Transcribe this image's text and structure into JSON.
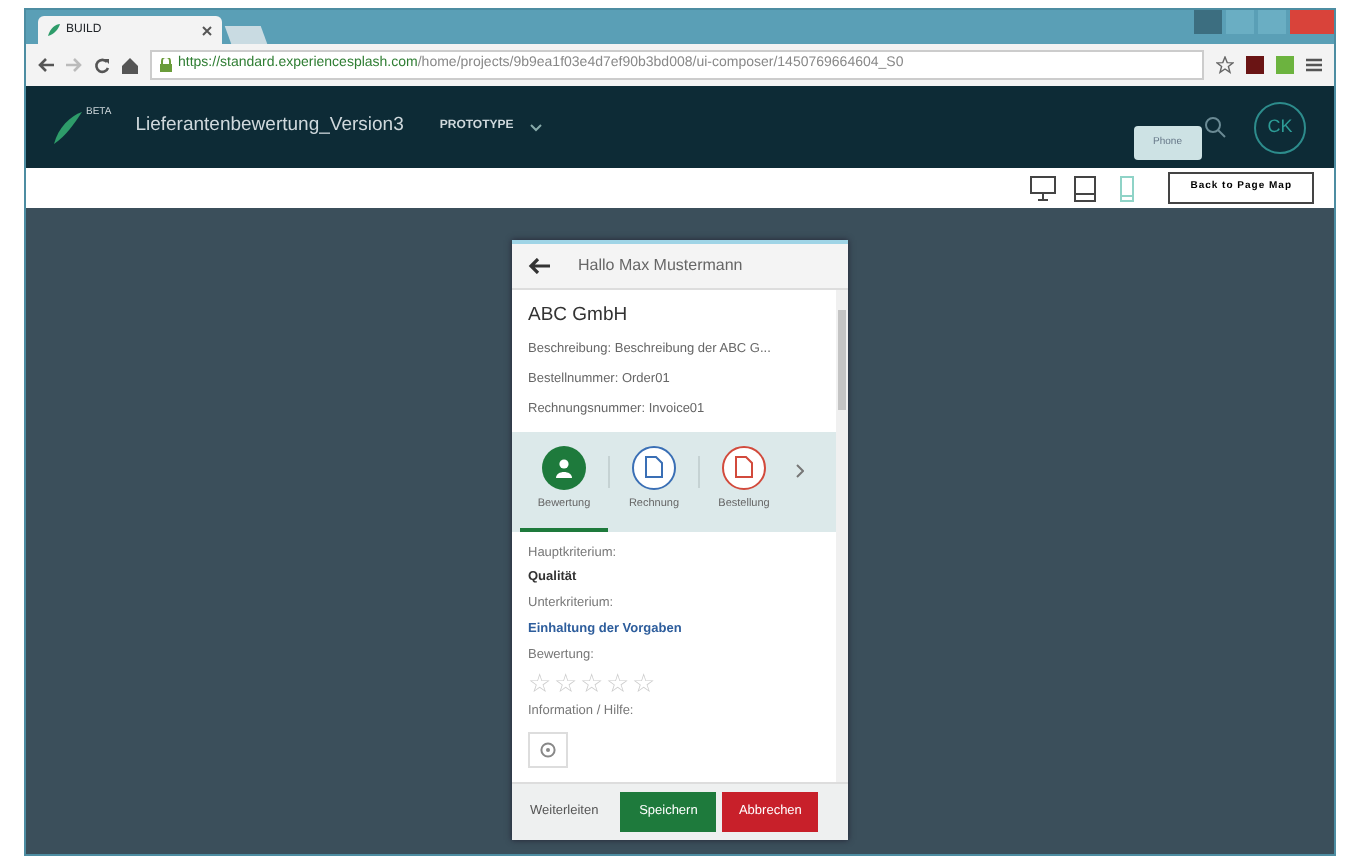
{
  "browser": {
    "tab_title": "BUILD",
    "url_host": "https://standard.experiencesplash.com",
    "url_path": "/home/projects/9b9ea1f03e4d7ef90b3bd008/ui-composer/1450769664604_S0"
  },
  "app": {
    "badge": "BETA",
    "project": "Lieferantenbewertung_Version3",
    "mode": "PROTOTYPE",
    "avatar": "CK"
  },
  "tooltip": "Phone",
  "devices": [
    {
      "kind": "desktop",
      "selected": false
    },
    {
      "kind": "tablet",
      "selected": false
    },
    {
      "kind": "phone",
      "selected": true
    }
  ],
  "back_button": "Back to Page Map",
  "phone": {
    "header": "Hallo Max Mustermann",
    "company": "ABC GmbH",
    "details": [
      "Beschreibung: Beschreibung der ABC G...",
      "Bestellnummer: Order01",
      "Rechnungsnummer: Invoice01"
    ],
    "tabs": [
      {
        "label": "Bewertung",
        "selected": true,
        "color": "#1e7a3c"
      },
      {
        "label": "Rechnung",
        "selected": false,
        "color": "#3a6fb5"
      },
      {
        "label": "Bestellung",
        "selected": false,
        "color": "#d24a3c"
      }
    ],
    "fields": [
      {
        "kind": "label",
        "text": "Hauptkriterium:"
      },
      {
        "kind": "value",
        "text": "Qualität"
      },
      {
        "kind": "label",
        "text": "Unterkriterium:"
      },
      {
        "kind": "link",
        "text": "Einhaltung der Vorgaben"
      },
      {
        "kind": "label",
        "text": "Bewertung:"
      },
      {
        "kind": "rating",
        "stars": 0
      },
      {
        "kind": "label",
        "text": "Information / Hilfe:"
      },
      {
        "kind": "help"
      }
    ],
    "buttons": [
      {
        "kind": "plain",
        "label": "Weiterleiten"
      },
      {
        "kind": "save",
        "label": "Speichern"
      },
      {
        "kind": "cancel",
        "label": "Abbrechen"
      }
    ]
  }
}
